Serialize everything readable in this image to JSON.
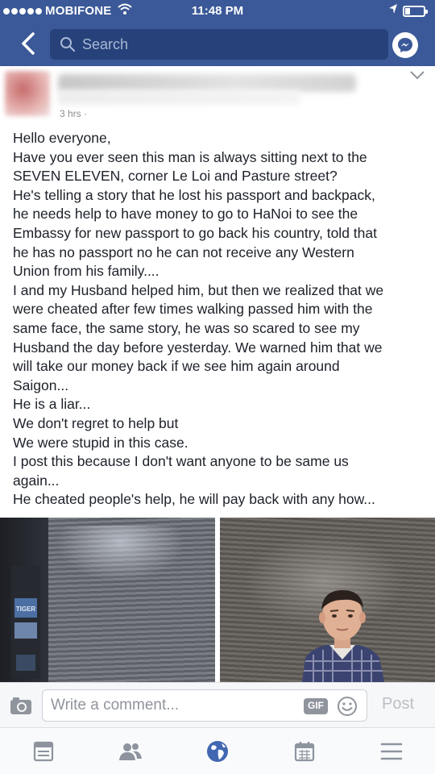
{
  "status_bar": {
    "carrier": "MOBIFONE",
    "time": "11:48 PM"
  },
  "nav": {
    "search_placeholder": "Search"
  },
  "post": {
    "meta": "3 hrs ·",
    "lines": [
      "Hello everyone,",
      "Have you ever seen this man is always sitting next to the",
      "SEVEN ELEVEN, corner Le Loi and Pasture street?",
      "He's telling a story that he lost his passport and backpack,",
      "he needs help to have money to go to HaNoi to see the",
      "Embassy for  new passport to go back his country, told that",
      "he has no passport no he can not receive any Western",
      "Union from his family....",
      "I and my Husband helped him, but then we realized that we",
      "were cheated after few times walking passed him with the",
      "same face, the same story, he was so scared to see my",
      "Husband the day before yesterday. We warned him that we",
      "will take our money back if we see him again around",
      "Saigon...",
      "He is a liar...",
      "We don't regret to help but",
      "We were stupid in this case.",
      "I post this because I don't want anyone to be same us",
      "again...",
      "He cheated people's help, he will pay back with any how..."
    ],
    "photo_left_sign": "TIGER"
  },
  "comment_bar": {
    "placeholder": "Write a comment...",
    "gif_label": "GIF",
    "post_label": "Post"
  },
  "tabs": [
    {
      "icon": "news-feed-icon"
    },
    {
      "icon": "friends-icon"
    },
    {
      "icon": "globe-icon"
    },
    {
      "icon": "calendar-icon"
    },
    {
      "icon": "menu-icon"
    }
  ],
  "colors": {
    "brand": "#3b5998",
    "search_bg": "#27427a",
    "text": "#1d2129",
    "tab_active": "#4267b2",
    "tab_inactive": "#8d949e"
  }
}
